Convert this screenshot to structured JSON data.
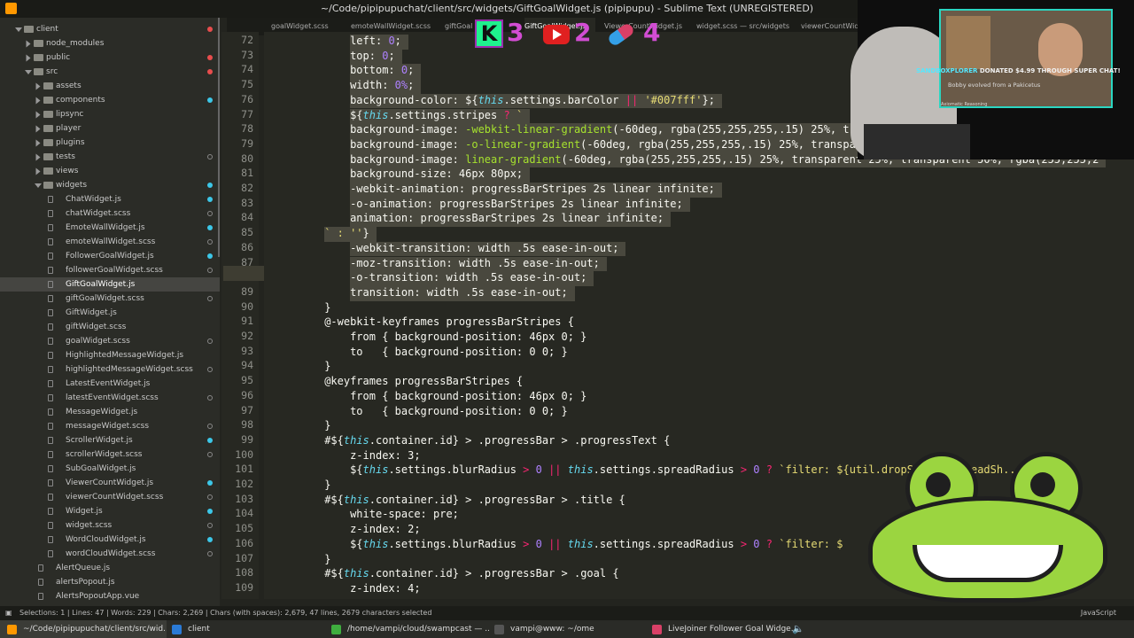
{
  "window": {
    "title": "~/Code/pipipupuchat/client/src/widgets/GiftGoalWidget.js (pipipupu) - Sublime Text (UNREGISTERED)"
  },
  "sidebar": {
    "items": [
      {
        "label": "client",
        "depth": 1,
        "type": "folder",
        "dot": "red",
        "open": true
      },
      {
        "label": "node_modules",
        "depth": 2,
        "type": "folder",
        "dot": "none"
      },
      {
        "label": "public",
        "depth": 2,
        "type": "folder",
        "dot": "red"
      },
      {
        "label": "src",
        "depth": 2,
        "type": "folder",
        "dot": "red",
        "open": true
      },
      {
        "label": "assets",
        "depth": 3,
        "type": "folder",
        "dot": "none"
      },
      {
        "label": "components",
        "depth": 3,
        "type": "folder",
        "dot": "cyan"
      },
      {
        "label": "lipsync",
        "depth": 3,
        "type": "folder",
        "dot": "none"
      },
      {
        "label": "player",
        "depth": 3,
        "type": "folder",
        "dot": "none"
      },
      {
        "label": "plugins",
        "depth": 3,
        "type": "folder",
        "dot": "none"
      },
      {
        "label": "tests",
        "depth": 3,
        "type": "folder",
        "dot": "hollow"
      },
      {
        "label": "views",
        "depth": 3,
        "type": "folder",
        "dot": "none"
      },
      {
        "label": "widgets",
        "depth": 3,
        "type": "folder",
        "dot": "cyan",
        "open": true
      },
      {
        "label": "ChatWidget.js",
        "depth": 4,
        "type": "file",
        "dot": "cyan"
      },
      {
        "label": "chatWidget.scss",
        "depth": 4,
        "type": "file",
        "dot": "hollow"
      },
      {
        "label": "EmoteWallWidget.js",
        "depth": 4,
        "type": "file",
        "dot": "cyan"
      },
      {
        "label": "emoteWallWidget.scss",
        "depth": 4,
        "type": "file",
        "dot": "hollow"
      },
      {
        "label": "FollowerGoalWidget.js",
        "depth": 4,
        "type": "file",
        "dot": "cyan"
      },
      {
        "label": "followerGoalWidget.scss",
        "depth": 4,
        "type": "file",
        "dot": "hollow"
      },
      {
        "label": "GiftGoalWidget.js",
        "depth": 4,
        "type": "file",
        "dot": "none",
        "selected": true
      },
      {
        "label": "giftGoalWidget.scss",
        "depth": 4,
        "type": "file",
        "dot": "hollow"
      },
      {
        "label": "GiftWidget.js",
        "depth": 4,
        "type": "file",
        "dot": "none"
      },
      {
        "label": "giftWidget.scss",
        "depth": 4,
        "type": "file",
        "dot": "none"
      },
      {
        "label": "goalWidget.scss",
        "depth": 4,
        "type": "file",
        "dot": "hollow"
      },
      {
        "label": "HighlightedMessageWidget.js",
        "depth": 4,
        "type": "file",
        "dot": "none"
      },
      {
        "label": "highlightedMessageWidget.scss",
        "depth": 4,
        "type": "file",
        "dot": "hollow"
      },
      {
        "label": "LatestEventWidget.js",
        "depth": 4,
        "type": "file",
        "dot": "none"
      },
      {
        "label": "latestEventWidget.scss",
        "depth": 4,
        "type": "file",
        "dot": "hollow"
      },
      {
        "label": "MessageWidget.js",
        "depth": 4,
        "type": "file",
        "dot": "none"
      },
      {
        "label": "messageWidget.scss",
        "depth": 4,
        "type": "file",
        "dot": "hollow"
      },
      {
        "label": "ScrollerWidget.js",
        "depth": 4,
        "type": "file",
        "dot": "cyan"
      },
      {
        "label": "scrollerWidget.scss",
        "depth": 4,
        "type": "file",
        "dot": "hollow"
      },
      {
        "label": "SubGoalWidget.js",
        "depth": 4,
        "type": "file",
        "dot": "none"
      },
      {
        "label": "ViewerCountWidget.js",
        "depth": 4,
        "type": "file",
        "dot": "cyan"
      },
      {
        "label": "viewerCountWidget.scss",
        "depth": 4,
        "type": "file",
        "dot": "hollow"
      },
      {
        "label": "Widget.js",
        "depth": 4,
        "type": "file",
        "dot": "cyan"
      },
      {
        "label": "widget.scss",
        "depth": 4,
        "type": "file",
        "dot": "hollow"
      },
      {
        "label": "WordCloudWidget.js",
        "depth": 4,
        "type": "file",
        "dot": "cyan"
      },
      {
        "label": "wordCloudWidget.scss",
        "depth": 4,
        "type": "file",
        "dot": "hollow"
      },
      {
        "label": "AlertQueue.js",
        "depth": 3,
        "type": "file",
        "dot": "none"
      },
      {
        "label": "alertsPopout.js",
        "depth": 3,
        "type": "file",
        "dot": "none"
      },
      {
        "label": "AlertsPopoutApp.vue",
        "depth": 3,
        "type": "file",
        "dot": "none"
      }
    ]
  },
  "tabs": [
    {
      "label": "goalWidget.scss"
    },
    {
      "label": "emoteWallWidget.scss"
    },
    {
      "label": "giftGoal"
    },
    {
      "label": "GiftGoalWidget.js",
      "active": true
    },
    {
      "label": "ViewerCountWidget.js"
    },
    {
      "label": "widget.scss — src/widgets"
    },
    {
      "label": "viewerCountWid"
    }
  ],
  "editor": {
    "current_line": 88,
    "lines": [
      {
        "n": 72,
        "i": 7,
        "t": [
          [
            "k",
            "left: "
          ],
          [
            "n",
            "0"
          ],
          [
            "k",
            ";"
          ]
        ]
      },
      {
        "n": 73,
        "i": 7,
        "t": [
          [
            "k",
            "top: "
          ],
          [
            "n",
            "0"
          ],
          [
            "k",
            ";"
          ]
        ]
      },
      {
        "n": 74,
        "i": 7,
        "t": [
          [
            "k",
            "bottom: "
          ],
          [
            "n",
            "0"
          ],
          [
            "k",
            ";"
          ]
        ]
      },
      {
        "n": 75,
        "i": 7,
        "t": [
          [
            "k",
            "width: "
          ],
          [
            "n",
            "0%"
          ],
          [
            "k",
            ";"
          ]
        ]
      },
      {
        "n": 76,
        "i": 7,
        "t": [
          [
            "k",
            "background-color: ${"
          ],
          [
            "kw",
            "this"
          ],
          [
            "k",
            ".settings.barColor "
          ],
          [
            "op",
            "||"
          ],
          [
            "s",
            " '#007fff'"
          ],
          [
            "k",
            "};"
          ]
        ]
      },
      {
        "n": 77,
        "i": 7,
        "t": [
          [
            "k",
            "${"
          ],
          [
            "kw",
            "this"
          ],
          [
            "k",
            ".settings.stripes "
          ],
          [
            "op",
            "?"
          ],
          [
            "s",
            " `"
          ]
        ]
      },
      {
        "n": 78,
        "i": 7,
        "t": [
          [
            "k",
            "background-image: "
          ],
          [
            "pk",
            "-webkit-linear-gradient"
          ],
          [
            "k",
            "(-60deg, rgba(255,255,255,.15) 25%, transparent 25%, transparent 50%, rgba(255,255,255,."
          ]
        ]
      },
      {
        "n": 79,
        "i": 7,
        "t": [
          [
            "k",
            "background-image: "
          ],
          [
            "pk",
            "-o-linear-gradient"
          ],
          [
            "k",
            "(-60deg, rgba(255,255,255,.15) 25%, transparent 25%, transparent 50%, rgba(255,255,"
          ]
        ]
      },
      {
        "n": 80,
        "i": 7,
        "t": [
          [
            "k",
            "background-image: "
          ],
          [
            "pk",
            "linear-gradient"
          ],
          [
            "k",
            "(-60deg, rgba(255,255,255,.15) 25%, transparent 25%, transparent 50%, rgba(255,255,2"
          ]
        ]
      },
      {
        "n": 81,
        "i": 7,
        "t": [
          [
            "k",
            "background-size: 46px 80px;"
          ]
        ]
      },
      {
        "n": 82,
        "i": 7,
        "t": [
          [
            "k",
            "-webkit-animation: progressBarStripes 2s linear infinite;"
          ]
        ]
      },
      {
        "n": 83,
        "i": 7,
        "t": [
          [
            "k",
            "-o-animation: progressBarStripes 2s linear infinite;"
          ]
        ]
      },
      {
        "n": 84,
        "i": 7,
        "t": [
          [
            "k",
            "animation: progressBarStripes 2s linear infinite;"
          ]
        ]
      },
      {
        "n": 85,
        "i": 5,
        "t": [
          [
            "s",
            "` : ''"
          ],
          [
            "k",
            "}"
          ]
        ]
      },
      {
        "n": 86,
        "i": 7,
        "t": [
          [
            "k",
            "-webkit-transition: width .5s ease-in-out;"
          ]
        ]
      },
      {
        "n": 87,
        "i": 7,
        "t": [
          [
            "k",
            "-moz-transition: width .5s ease-in-out;"
          ]
        ]
      },
      {
        "n": 88,
        "i": 7,
        "t": [
          [
            "k",
            "-o-transition: width .5s ease-in-out;"
          ]
        ]
      },
      {
        "n": 89,
        "i": 7,
        "t": [
          [
            "k",
            "transition: width .5s ease-in-out;"
          ]
        ]
      },
      {
        "n": 90,
        "i": 5,
        "t": [
          [
            "k",
            "}"
          ]
        ]
      },
      {
        "n": 91,
        "i": 5,
        "t": [
          [
            "k",
            "@-webkit-keyframes progressBarStripes {"
          ]
        ]
      },
      {
        "n": 92,
        "i": 7,
        "t": [
          [
            "k",
            "from { background-position: 46px 0; }"
          ]
        ]
      },
      {
        "n": 93,
        "i": 7,
        "t": [
          [
            "k",
            "to   { background-position: 0 0; }"
          ]
        ]
      },
      {
        "n": 94,
        "i": 5,
        "t": [
          [
            "k",
            "}"
          ]
        ]
      },
      {
        "n": 95,
        "i": 5,
        "t": [
          [
            "k",
            "@keyframes progressBarStripes {"
          ]
        ]
      },
      {
        "n": 96,
        "i": 7,
        "t": [
          [
            "k",
            "from { background-position: 46px 0; }"
          ]
        ]
      },
      {
        "n": 97,
        "i": 7,
        "t": [
          [
            "k",
            "to   { background-position: 0 0; }"
          ]
        ]
      },
      {
        "n": 98,
        "i": 5,
        "t": [
          [
            "k",
            "}"
          ]
        ]
      },
      {
        "n": 99,
        "i": 5,
        "t": [
          [
            "k",
            "#${"
          ],
          [
            "kw",
            "this"
          ],
          [
            "k",
            ".container.id} > .progressBar > .progressText {"
          ]
        ]
      },
      {
        "n": 100,
        "i": 7,
        "t": [
          [
            "k",
            "z-index: 3;"
          ]
        ]
      },
      {
        "n": 101,
        "i": 7,
        "t": [
          [
            "k",
            "${"
          ],
          [
            "kw",
            "this"
          ],
          [
            "k",
            ".settings.blurRadius "
          ],
          [
            "op",
            ">"
          ],
          [
            "n",
            " 0 "
          ],
          [
            "op",
            "||"
          ],
          [
            "k",
            " "
          ],
          [
            "kw",
            "this"
          ],
          [
            "k",
            ".settings.spreadRadius "
          ],
          [
            "op",
            ">"
          ],
          [
            "n",
            " 0 "
          ],
          [
            "op",
            "?"
          ],
          [
            "s",
            " `filter: ${util.dropShadow(spreadSh...(this.se"
          ]
        ]
      },
      {
        "n": 102,
        "i": 5,
        "t": [
          [
            "k",
            "}"
          ]
        ]
      },
      {
        "n": 103,
        "i": 5,
        "t": [
          [
            "k",
            "#${"
          ],
          [
            "kw",
            "this"
          ],
          [
            "k",
            ".container.id} > .progressBar > .title {"
          ]
        ]
      },
      {
        "n": 104,
        "i": 7,
        "t": [
          [
            "k",
            "white-space: pre;"
          ]
        ]
      },
      {
        "n": 105,
        "i": 7,
        "t": [
          [
            "k",
            "z-index: 2;"
          ]
        ]
      },
      {
        "n": 106,
        "i": 7,
        "t": [
          [
            "k",
            "${"
          ],
          [
            "kw",
            "this"
          ],
          [
            "k",
            ".settings.blurRadius "
          ],
          [
            "op",
            ">"
          ],
          [
            "n",
            " 0 "
          ],
          [
            "op",
            "||"
          ],
          [
            "k",
            " "
          ],
          [
            "kw",
            "this"
          ],
          [
            "k",
            ".settings.spreadRadius "
          ],
          [
            "op",
            ">"
          ],
          [
            "n",
            " 0 "
          ],
          [
            "op",
            "?"
          ],
          [
            "s",
            " `filter: $"
          ]
        ]
      },
      {
        "n": 107,
        "i": 5,
        "t": [
          [
            "k",
            "}"
          ]
        ]
      },
      {
        "n": 108,
        "i": 5,
        "t": [
          [
            "k",
            "#${"
          ],
          [
            "kw",
            "this"
          ],
          [
            "k",
            ".container.id} > .progressBar > .goal {"
          ]
        ]
      },
      {
        "n": 109,
        "i": 7,
        "t": [
          [
            "k",
            "z-index: 4;"
          ]
        ]
      }
    ]
  },
  "status": {
    "left": "Selections: 1 | Lines: 47 | Words: 229 | Chars: 2,269 | Chars (with spaces): 2,679, 47 lines, 2679 characters selected",
    "right": "JavaScript"
  },
  "taskbar": [
    {
      "label": "~/Code/pipipupuchat/client/src/wid...",
      "active": true
    },
    {
      "label": "client"
    },
    {
      "label": "/home/vampi/cloud/swampcast — ..."
    },
    {
      "label": "vampi@www: ~/ome"
    },
    {
      "label": "LiveJoiner Follower Goal Widge..."
    }
  ],
  "overlay": {
    "counts": [
      {
        "icon": "kick-icon",
        "value": "3"
      },
      {
        "icon": "youtube-icon",
        "value": "2"
      },
      {
        "icon": "pill-icon",
        "value": "4"
      }
    ],
    "donation": {
      "name": "SANDBOXPLORER",
      "text": " DONATED $4.99 THROUGH SUPER CHAT!"
    },
    "evolved": "Bobby evolved from a Pakicetus",
    "channel": "Axiomatic Reasoning"
  }
}
